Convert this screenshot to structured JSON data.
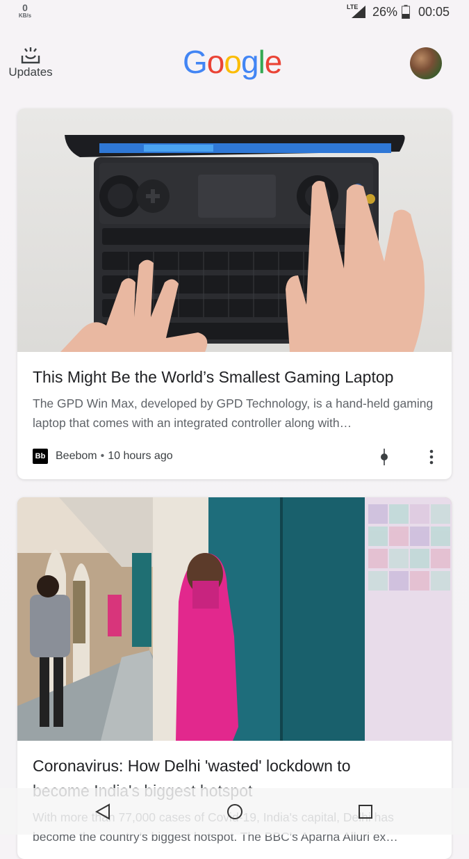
{
  "status_bar": {
    "speed_value": "0",
    "speed_unit": "KB/s",
    "network": "LTE",
    "battery": "26%",
    "time": "00:05"
  },
  "header": {
    "updates_label": "Updates",
    "logo": [
      "G",
      "o",
      "o",
      "g",
      "l",
      "e"
    ],
    "logo_colors": [
      "#4285F4",
      "#EA4335",
      "#FBBC05",
      "#4285F4",
      "#34A853",
      "#EA4335"
    ]
  },
  "cards": [
    {
      "title": "This Might Be the World’s Smallest Gaming Laptop",
      "snippet": "The GPD Win Max, developed by GPD Technology, is a hand-held gaming laptop that comes with an integrated controller along with…",
      "source_logo": "Bb",
      "source": "Beebom",
      "time": "10 hours ago"
    },
    {
      "title_line1": "Coronavirus: How Delhi 'wasted' lockdown to",
      "title_line2": "become India's biggest hotspot",
      "snippet": "With more than 77,000 cases of Covid-19, India's capital, Delhi has become the country's biggest hotspot. The BBC's Aparna Alluri ex…"
    }
  ],
  "nav": {
    "back": "back-icon",
    "home": "home-icon",
    "recents": "recents-icon"
  }
}
